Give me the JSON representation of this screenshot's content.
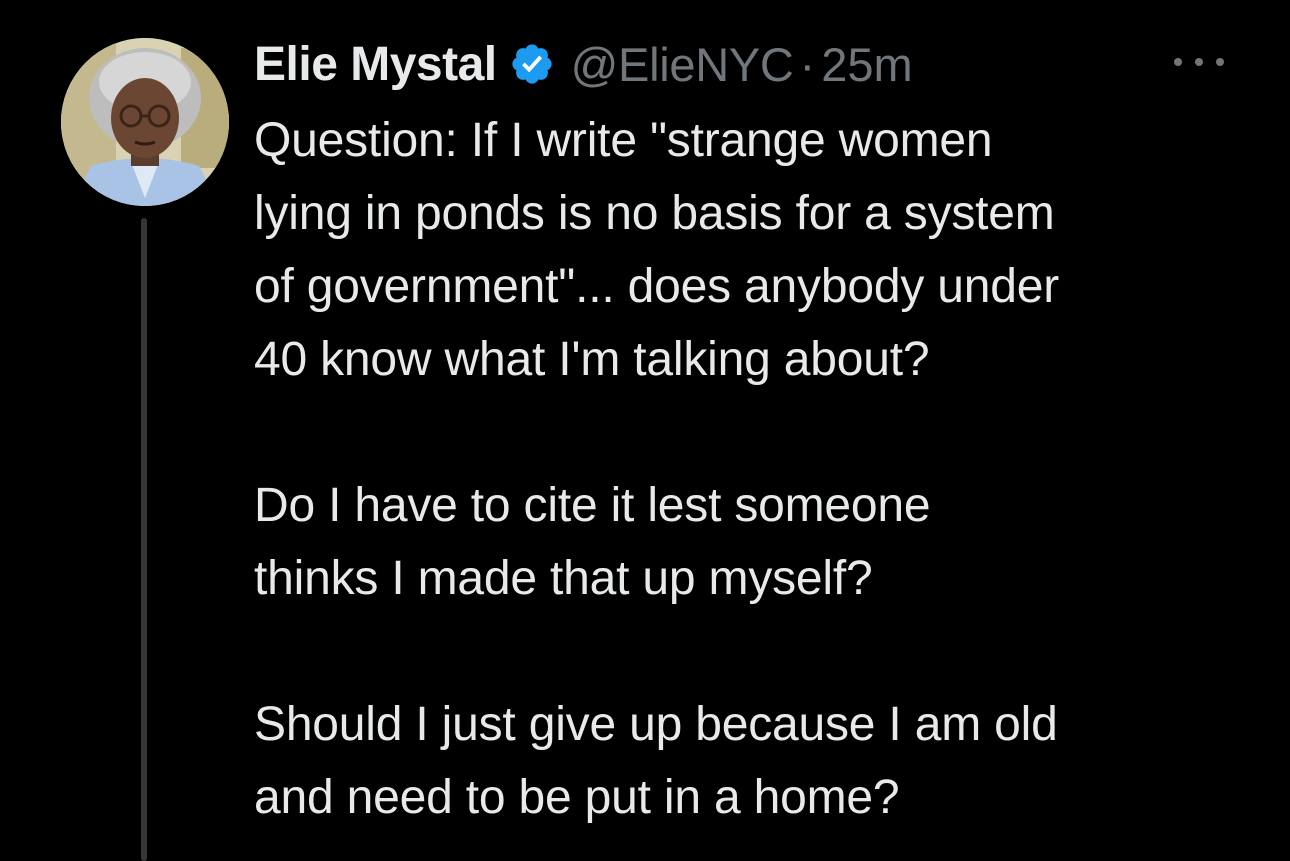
{
  "tweet": {
    "author": {
      "display_name": "Elie Mystal",
      "verified_icon": "verified-badge-icon",
      "handle": "@ElieNYC",
      "separator": "·",
      "time_ago": "25m"
    },
    "more_icon": "more-dots-icon",
    "paragraphs": [
      "Question: If I write \"strange women\nlying in ponds is no basis for a system\nof government\"... does anybody under\n40 know what I'm talking about?",
      "Do I have to cite it lest someone\nthinks I made that up myself?",
      "Should I just give up because I am old\nand need to be put in a home?"
    ]
  },
  "colors": {
    "background": "#000000",
    "text_primary": "#e7e9ea",
    "text_secondary": "#71767b",
    "verified_blue": "#1d9bf0",
    "thread_line": "#333639"
  }
}
